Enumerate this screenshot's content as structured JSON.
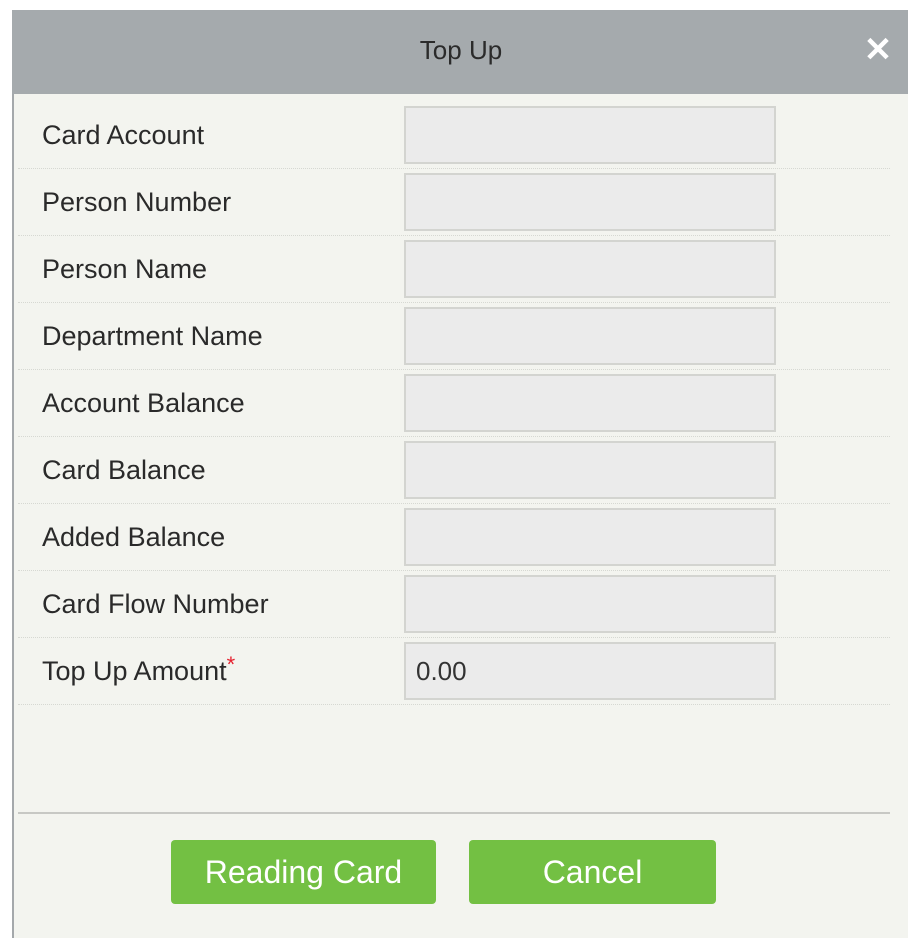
{
  "dialog": {
    "title": "Top Up",
    "close_glyph": "✕",
    "close_icon": "close-icon"
  },
  "form": {
    "fields": [
      {
        "label": "Card Account",
        "value": "",
        "required": false
      },
      {
        "label": "Person Number",
        "value": "",
        "required": false
      },
      {
        "label": "Person Name",
        "value": "",
        "required": false
      },
      {
        "label": "Department Name",
        "value": "",
        "required": false
      },
      {
        "label": "Account Balance",
        "value": "",
        "required": false
      },
      {
        "label": "Card Balance",
        "value": "",
        "required": false
      },
      {
        "label": "Added Balance",
        "value": "",
        "required": false
      },
      {
        "label": "Card Flow Number",
        "value": "",
        "required": false
      },
      {
        "label": "Top Up Amount",
        "value": "0.00",
        "required": true,
        "required_mark": "*"
      }
    ]
  },
  "buttons": {
    "reading_card": "Reading Card",
    "cancel": "Cancel"
  },
  "colors": {
    "titlebar": "#a5aaad",
    "body": "#f3f4ef",
    "button": "#73c043",
    "required": "#e5212f"
  }
}
